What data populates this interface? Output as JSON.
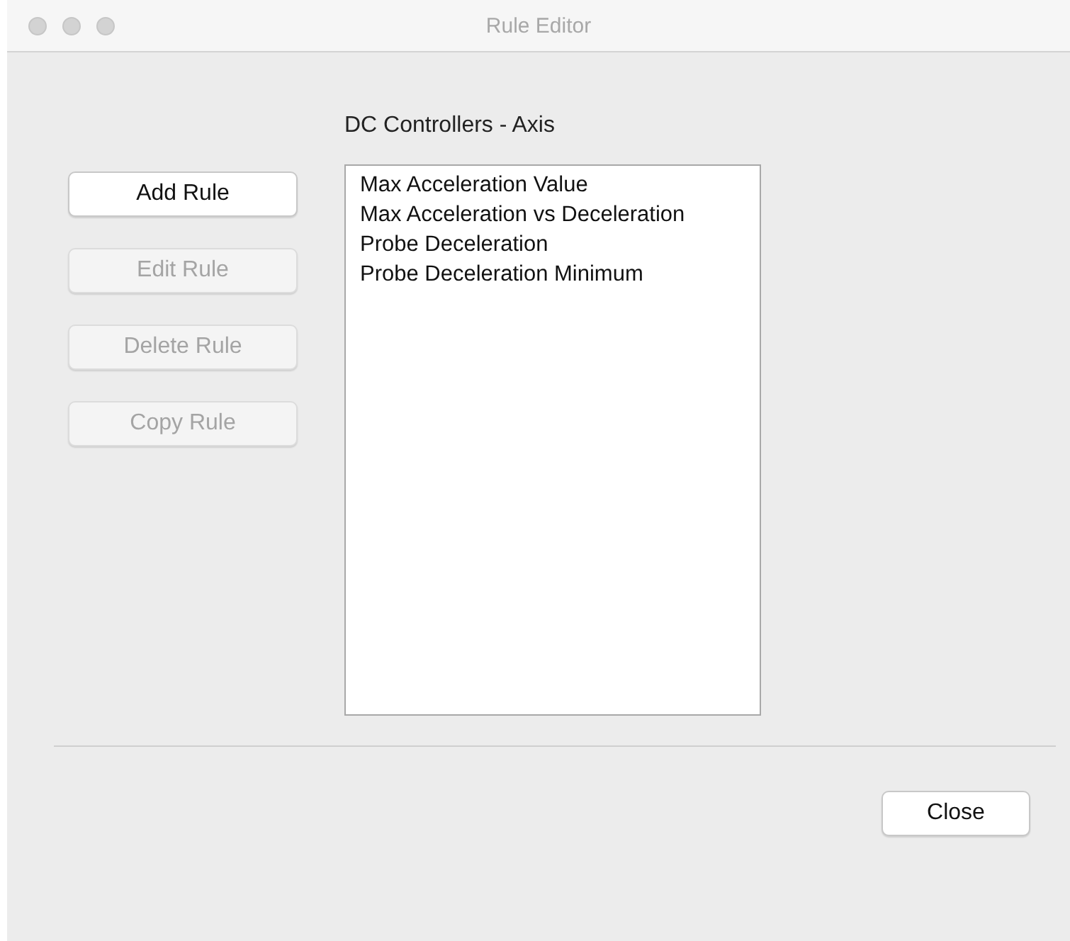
{
  "window": {
    "title": "Rule Editor"
  },
  "heading": "DC Controllers - Axis",
  "buttons": [
    {
      "label": "Add Rule",
      "disabled": false
    },
    {
      "label": "Edit Rule",
      "disabled": true
    },
    {
      "label": "Delete Rule",
      "disabled": true
    },
    {
      "label": "Copy Rule",
      "disabled": true
    }
  ],
  "rules": [
    "Max Acceleration Value",
    "Max Acceleration vs Deceleration",
    "Probe Deceleration",
    "Probe Deceleration Minimum"
  ],
  "close_button": {
    "label": "Close"
  }
}
